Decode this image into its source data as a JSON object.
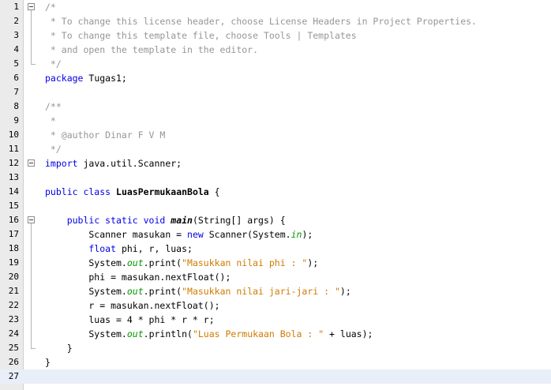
{
  "editor": {
    "current_line": 27,
    "lines": [
      {
        "n": "1",
        "fold": "start",
        "tokens": [
          {
            "t": "/*",
            "c": "comment"
          }
        ]
      },
      {
        "n": "2",
        "tokens": [
          {
            "t": " * To change this license header, choose License Headers in Project Properties.",
            "c": "comment"
          }
        ]
      },
      {
        "n": "3",
        "tokens": [
          {
            "t": " * To change this template file, choose Tools | Templates",
            "c": "comment"
          }
        ]
      },
      {
        "n": "4",
        "tokens": [
          {
            "t": " * and open the template in the editor.",
            "c": "comment"
          }
        ]
      },
      {
        "n": "5",
        "fold": "end",
        "tokens": [
          {
            "t": " */",
            "c": "comment"
          }
        ]
      },
      {
        "n": "6",
        "tokens": [
          {
            "t": "package",
            "c": "kw"
          },
          {
            "t": " Tugas1;",
            "c": ""
          }
        ]
      },
      {
        "n": "7",
        "tokens": []
      },
      {
        "n": "8",
        "tokens": [
          {
            "t": "/**",
            "c": "comment"
          }
        ]
      },
      {
        "n": "9",
        "tokens": [
          {
            "t": " *",
            "c": "comment"
          }
        ]
      },
      {
        "n": "10",
        "tokens": [
          {
            "t": " * @author Dinar F V M",
            "c": "comment"
          }
        ]
      },
      {
        "n": "11",
        "tokens": [
          {
            "t": " */",
            "c": "comment"
          }
        ]
      },
      {
        "n": "12",
        "fold": "start",
        "tokens": [
          {
            "t": "import",
            "c": "kw"
          },
          {
            "t": " java.util.Scanner;",
            "c": ""
          }
        ]
      },
      {
        "n": "13",
        "tokens": []
      },
      {
        "n": "14",
        "tokens": [
          {
            "t": "public class",
            "c": "kw"
          },
          {
            "t": " ",
            "c": ""
          },
          {
            "t": "LuasPermukaanBola",
            "c": "bold"
          },
          {
            "t": " {",
            "c": ""
          }
        ]
      },
      {
        "n": "15",
        "tokens": []
      },
      {
        "n": "16",
        "fold": "start",
        "tokens": [
          {
            "t": "    ",
            "c": ""
          },
          {
            "t": "public static void",
            "c": "kw"
          },
          {
            "t": " ",
            "c": ""
          },
          {
            "t": "main",
            "c": "bolditalic"
          },
          {
            "t": "(String[] args) {",
            "c": ""
          }
        ]
      },
      {
        "n": "17",
        "tokens": [
          {
            "t": "        Scanner masukan = ",
            "c": ""
          },
          {
            "t": "new",
            "c": "kw"
          },
          {
            "t": " Scanner(System.",
            "c": ""
          },
          {
            "t": "in",
            "c": "field italic"
          },
          {
            "t": ");",
            "c": ""
          }
        ]
      },
      {
        "n": "18",
        "tokens": [
          {
            "t": "        ",
            "c": ""
          },
          {
            "t": "float",
            "c": "kw"
          },
          {
            "t": " phi, r, luas;",
            "c": ""
          }
        ]
      },
      {
        "n": "19",
        "tokens": [
          {
            "t": "        System.",
            "c": ""
          },
          {
            "t": "out",
            "c": "field italic"
          },
          {
            "t": ".print(",
            "c": ""
          },
          {
            "t": "\"Masukkan nilai phi : \"",
            "c": "str"
          },
          {
            "t": ");",
            "c": ""
          }
        ]
      },
      {
        "n": "20",
        "tokens": [
          {
            "t": "        phi = masukan.nextFloat();",
            "c": ""
          }
        ]
      },
      {
        "n": "21",
        "tokens": [
          {
            "t": "        System.",
            "c": ""
          },
          {
            "t": "out",
            "c": "field italic"
          },
          {
            "t": ".print(",
            "c": ""
          },
          {
            "t": "\"Masukkan nilai jari-jari : \"",
            "c": "str"
          },
          {
            "t": ");",
            "c": ""
          }
        ]
      },
      {
        "n": "22",
        "tokens": [
          {
            "t": "        r = masukan.nextFloat();",
            "c": ""
          }
        ]
      },
      {
        "n": "23",
        "tokens": [
          {
            "t": "        luas = 4 * phi * r * r;",
            "c": ""
          }
        ]
      },
      {
        "n": "24",
        "tokens": [
          {
            "t": "        System.",
            "c": ""
          },
          {
            "t": "out",
            "c": "field italic"
          },
          {
            "t": ".println(",
            "c": ""
          },
          {
            "t": "\"Luas Permukaan Bola : \"",
            "c": "str"
          },
          {
            "t": " + luas);",
            "c": ""
          }
        ]
      },
      {
        "n": "25",
        "fold": "end",
        "tokens": [
          {
            "t": "    }",
            "c": ""
          }
        ]
      },
      {
        "n": "26",
        "tokens": [
          {
            "t": "}",
            "c": ""
          }
        ]
      },
      {
        "n": "27",
        "tokens": []
      }
    ]
  },
  "colors": {
    "keyword": "#0000e6",
    "comment": "#969696",
    "string": "#ce7b00",
    "field": "#009900",
    "gutter": "#ebebeb",
    "current_line": "#e9eff8"
  }
}
